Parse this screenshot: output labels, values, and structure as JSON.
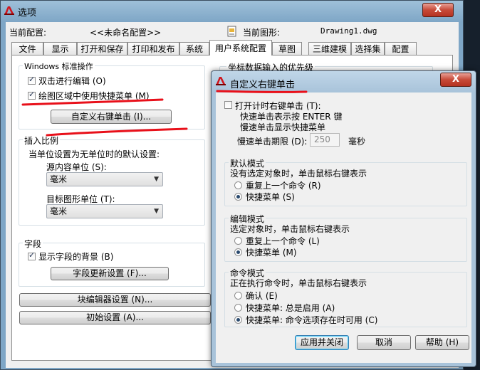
{
  "main_window": {
    "title": "选项",
    "close_glyph": "X",
    "current_profile_label": "当前配置:",
    "current_profile_value": "<<未命名配置>>",
    "current_drawing_label": "当前图形:",
    "current_drawing_value": "Drawing1.dwg"
  },
  "tabs": [
    {
      "label": "文件"
    },
    {
      "label": "显示"
    },
    {
      "label": "打开和保存"
    },
    {
      "label": "打印和发布"
    },
    {
      "label": "系统"
    },
    {
      "label": "用户系统配置"
    },
    {
      "label": "草图"
    },
    {
      "label": "三维建模"
    },
    {
      "label": "选择集"
    },
    {
      "label": "配置"
    }
  ],
  "windows_group": {
    "title": "Windows 标准操作",
    "dblclick_label": "双击进行编辑 (O)",
    "shortcut_menu_label": "绘图区域中使用快捷菜单 (M)",
    "custom_rightclick_button": "自定义右键单击 (I)..."
  },
  "insert_scale_group": {
    "title": "插入比例",
    "desc": "当单位设置为无单位时的默认设置:",
    "source_label": "源内容单位 (S):",
    "source_value": "毫米",
    "target_label": "目标图形单位 (T):",
    "target_value": "毫米"
  },
  "field_group": {
    "title": "字段",
    "show_bg_label": "显示字段的背景 (B)",
    "update_button": "字段更新设置 (F)..."
  },
  "block_editor_button": "块编辑器设置 (N)...",
  "initial_settings_button": "初始设置 (A)...",
  "coord_group_title": "坐标数据输入的优先级",
  "dialog": {
    "title": "自定义右键单击",
    "close_glyph": "X",
    "timer_label": "打开计时右键单击 (T):",
    "quick_click_text": "快速单击表示按 ENTER 键",
    "slow_click_text": "慢速单击显示快捷菜单",
    "slow_period_label": "慢速单击期限 (D):",
    "slow_period_value": "250",
    "slow_period_unit": "毫秒",
    "default_mode": {
      "title": "默认模式",
      "desc": "没有选定对象时，单击鼠标右键表示",
      "option1": "重复上一个命令 (R)",
      "option2": "快捷菜单 (S)"
    },
    "edit_mode": {
      "title": "编辑模式",
      "desc": "选定对象时，单击鼠标右键表示",
      "option1": "重复上一个命令 (L)",
      "option2": "快捷菜单 (M)"
    },
    "command_mode": {
      "title": "命令模式",
      "desc": "正在执行命令时，单击鼠标右键表示",
      "option1": "确认 (E)",
      "option2": "快捷菜单: 总是启用 (A)",
      "option3": "快捷菜单: 命令选项存在时可用 (C)"
    },
    "apply_close_button": "应用并关闭",
    "cancel_button": "取消",
    "help_button": "帮助 (H)"
  },
  "colors": {
    "annotation": "#e8101a",
    "app_icon": "#d0141c"
  }
}
